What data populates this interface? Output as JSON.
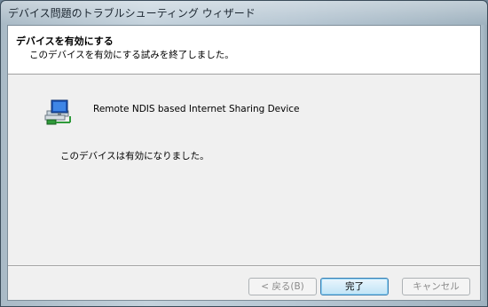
{
  "window": {
    "title": "デバイス問題のトラブルシューティング ウィザード"
  },
  "header": {
    "title": "デバイスを有効にする",
    "subtitle": "このデバイスを有効にする試みを終了しました。"
  },
  "device": {
    "icon": "network-adapter-icon",
    "name": "Remote NDIS based Internet Sharing Device"
  },
  "status": {
    "message": "このデバイスは有効になりました。"
  },
  "buttons": {
    "back_label": "< 戻る(B)",
    "finish_label": "完了",
    "cancel_label": "キャンセル"
  }
}
